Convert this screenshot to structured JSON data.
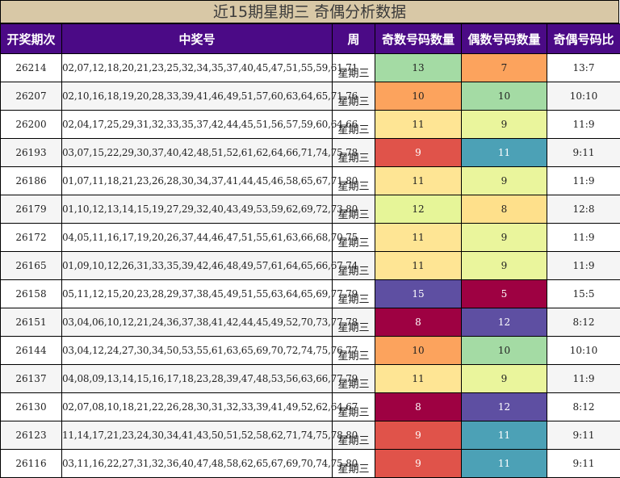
{
  "title": "近15期星期三 奇偶分析数据",
  "headers": [
    "开奖期次",
    "中奖号",
    "周",
    "奇数号码数量",
    "偶数号码数量",
    "奇偶号码比"
  ],
  "colors": {
    "header_bg": "#4b0a86",
    "title_bg": "#d8c8a6",
    "scale": {
      "5": "#9e0142",
      "7": "#fca35d",
      "8": "#e5e9a0",
      "9": "#e6f598",
      "10": "#a4dba4",
      "11": "#4ca1b6",
      "12": "#fee08b",
      "13": "#a4dba4",
      "15": "#5e4fa2"
    }
  },
  "rows": [
    {
      "issue": "26214",
      "numbers": "02,07,12,18,20,21,23,25,32,34,35,37,40,45,47,51,55,59,61,71",
      "week": "星期三",
      "odd": "13",
      "even": "7",
      "ratio": "13:7",
      "odd_color": "#a4dba4",
      "even_color": "#fca35d",
      "odd_fg": "#222",
      "even_fg": "#222"
    },
    {
      "issue": "26207",
      "numbers": "02,10,16,18,19,20,28,33,39,41,46,49,51,57,60,63,64,65,71,76",
      "week": "星期三",
      "odd": "10",
      "even": "10",
      "ratio": "10:10",
      "odd_color": "#fca35d",
      "even_color": "#a4dba4",
      "odd_fg": "#222",
      "even_fg": "#222"
    },
    {
      "issue": "26200",
      "numbers": "02,04,17,25,29,31,32,33,35,37,42,44,45,51,56,57,59,60,64,66",
      "week": "星期三",
      "odd": "11",
      "even": "9",
      "ratio": "11:9",
      "odd_color": "#fee594",
      "even_color": "#eaf59c",
      "odd_fg": "#222",
      "even_fg": "#222"
    },
    {
      "issue": "26193",
      "numbers": "03,07,15,22,29,30,37,40,42,48,51,52,61,62,64,66,71,74,75,78",
      "week": "星期三",
      "odd": "9",
      "even": "11",
      "ratio": "9:11",
      "odd_color": "#e0534a",
      "even_color": "#4ca1b6",
      "odd_fg": "#ffffff",
      "even_fg": "#ffffff"
    },
    {
      "issue": "26186",
      "numbers": "01,07,11,18,21,23,26,28,30,34,37,41,44,45,46,58,65,67,71,80",
      "week": "星期三",
      "odd": "11",
      "even": "9",
      "ratio": "11:9",
      "odd_color": "#fee594",
      "even_color": "#eaf59c",
      "odd_fg": "#222",
      "even_fg": "#222"
    },
    {
      "issue": "26179",
      "numbers": "01,10,12,13,14,15,19,27,29,32,40,43,49,53,59,62,69,72,73,80",
      "week": "星期三",
      "odd": "12",
      "even": "8",
      "ratio": "12:8",
      "odd_color": "#e6f598",
      "even_color": "#fee08b",
      "odd_fg": "#222",
      "even_fg": "#222"
    },
    {
      "issue": "26172",
      "numbers": "04,05,11,16,17,19,20,26,37,44,46,47,51,55,61,63,66,68,70,75",
      "week": "星期三",
      "odd": "11",
      "even": "9",
      "ratio": "11:9",
      "odd_color": "#fee594",
      "even_color": "#eaf59c",
      "odd_fg": "#222",
      "even_fg": "#222"
    },
    {
      "issue": "26165",
      "numbers": "01,09,10,12,26,31,33,35,39,42,46,48,49,57,61,64,65,66,67,74",
      "week": "星期三",
      "odd": "11",
      "even": "9",
      "ratio": "11:9",
      "odd_color": "#fee594",
      "even_color": "#eaf59c",
      "odd_fg": "#222",
      "even_fg": "#222"
    },
    {
      "issue": "26158",
      "numbers": "05,11,12,15,20,23,28,29,37,38,45,49,51,55,63,64,65,69,77,79",
      "week": "星期三",
      "odd": "15",
      "even": "5",
      "ratio": "15:5",
      "odd_color": "#5e4fa2",
      "even_color": "#9e0142",
      "odd_fg": "#ffffff",
      "even_fg": "#ffffff"
    },
    {
      "issue": "26151",
      "numbers": "03,04,06,10,12,21,24,36,37,38,41,42,44,45,49,52,70,73,77,78",
      "week": "星期三",
      "odd": "8",
      "even": "12",
      "ratio": "8:12",
      "odd_color": "#9e0142",
      "even_color": "#5e4fa2",
      "odd_fg": "#ffffff",
      "even_fg": "#ffffff"
    },
    {
      "issue": "26144",
      "numbers": "03,04,12,24,27,30,34,50,53,55,61,63,65,69,70,72,74,75,76,77",
      "week": "星期三",
      "odd": "10",
      "even": "10",
      "ratio": "10:10",
      "odd_color": "#fca35d",
      "even_color": "#a4dba4",
      "odd_fg": "#222",
      "even_fg": "#222"
    },
    {
      "issue": "26137",
      "numbers": "04,08,09,13,14,15,16,17,18,23,28,39,47,48,53,56,63,66,77,79",
      "week": "星期三",
      "odd": "11",
      "even": "9",
      "ratio": "11:9",
      "odd_color": "#fee594",
      "even_color": "#eaf59c",
      "odd_fg": "#222",
      "even_fg": "#222"
    },
    {
      "issue": "26130",
      "numbers": "02,07,08,10,18,21,22,26,28,30,31,32,33,39,41,49,52,62,64,67",
      "week": "星期三",
      "odd": "8",
      "even": "12",
      "ratio": "8:12",
      "odd_color": "#9e0142",
      "even_color": "#5e4fa2",
      "odd_fg": "#ffffff",
      "even_fg": "#ffffff"
    },
    {
      "issue": "26123",
      "numbers": "11,14,17,21,23,24,30,34,41,43,50,51,52,58,62,71,74,75,78,80",
      "week": "星期三",
      "odd": "9",
      "even": "11",
      "ratio": "9:11",
      "odd_color": "#e0534a",
      "even_color": "#4ca1b6",
      "odd_fg": "#ffffff",
      "even_fg": "#ffffff"
    },
    {
      "issue": "26116",
      "numbers": "03,11,16,22,27,31,32,36,40,47,48,58,62,65,67,69,70,74,75,80",
      "week": "星期三",
      "odd": "9",
      "even": "11",
      "ratio": "9:11",
      "odd_color": "#e0534a",
      "even_color": "#4ca1b6",
      "odd_fg": "#ffffff",
      "even_fg": "#ffffff"
    }
  ]
}
